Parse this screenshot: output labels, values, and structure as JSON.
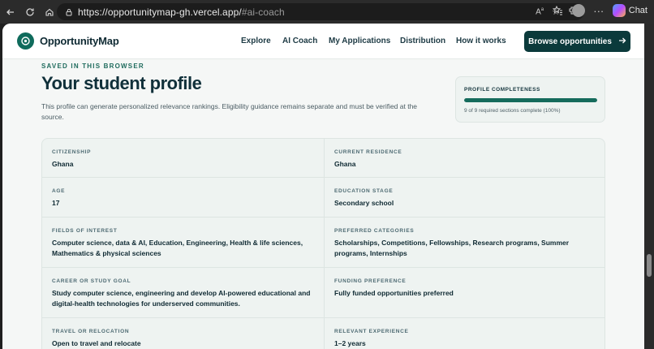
{
  "browser": {
    "url_host": "https://opportunitymap-gh.vercel.app/",
    "url_path": "#ai-coach",
    "chat_label": "Chat"
  },
  "header": {
    "brand": "OpportunityMap",
    "nav": [
      "Explore",
      "AI Coach",
      "My Applications",
      "Distribution",
      "How it works"
    ],
    "cta": "Browse opportunities"
  },
  "profile": {
    "eyebrow": "SAVED IN THIS BROWSER",
    "title": "Your student profile",
    "description": "This profile can generate personalized relevance rankings. Eligibility guidance remains separate and must be verified at the source."
  },
  "completeness": {
    "label": "PROFILE COMPLETENESS",
    "progress": 1.0,
    "summary": "9 of 9 required sections complete (100%)"
  },
  "fields": [
    {
      "label": "CITIZENSHIP",
      "value": "Ghana"
    },
    {
      "label": "CURRENT RESIDENCE",
      "value": "Ghana"
    },
    {
      "label": "AGE",
      "value": "17"
    },
    {
      "label": "EDUCATION STAGE",
      "value": "Secondary school"
    },
    {
      "label": "FIELDS OF INTEREST",
      "value": "Computer science, data & AI, Education, Engineering, Health & life sciences, Mathematics & physical sciences"
    },
    {
      "label": "PREFERRED CATEGORIES",
      "value": "Scholarships, Competitions, Fellowships, Research programs, Summer programs, Internships"
    },
    {
      "label": "CAREER OR STUDY GOAL",
      "value": "Study computer science, engineering and develop AI-powered educational and digital-health technologies for underserved communities."
    },
    {
      "label": "FUNDING PREFERENCE",
      "value": "Fully funded opportunities preferred"
    },
    {
      "label": "TRAVEL OR RELOCATION",
      "value": "Open to travel and relocate"
    },
    {
      "label": "RELEVANT EXPERIENCE",
      "value": "1–2 years"
    }
  ],
  "colors": {
    "brand": "#0f6b5c",
    "cta_bg": "#0b3a3b"
  }
}
